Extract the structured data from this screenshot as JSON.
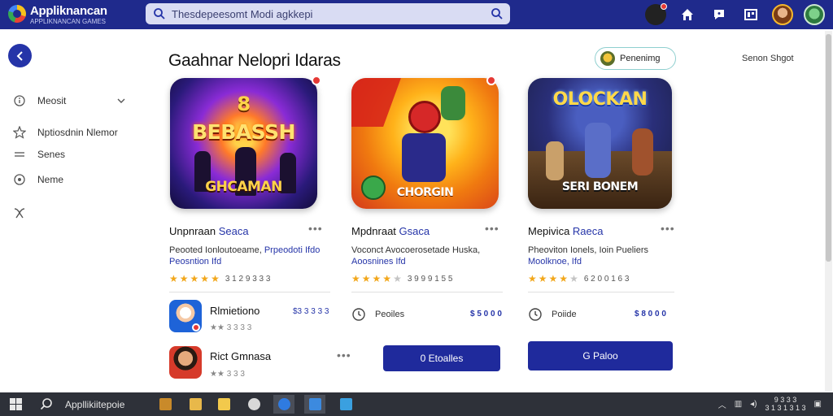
{
  "app": {
    "name": "Appliknancan",
    "tagline": "APPLIKNANCAN GAMES"
  },
  "search": {
    "placeholder": "Thesdepeesomt Modi agkkepi",
    "icon": "search-icon"
  },
  "topbar": {
    "icons": [
      "profile-avatar-icon",
      "home-icon",
      "chat-icon",
      "library-icon",
      "user-avatar-icon",
      "account-avatar-icon"
    ]
  },
  "sidebar": {
    "back": "back-icon",
    "items": [
      {
        "label": "Meosit",
        "icon": "info-icon"
      },
      {
        "label": "Nptiosdnin Nlemor",
        "icon": "star-icon"
      },
      {
        "label": "Senes",
        "icon": "menu-icon"
      },
      {
        "label": "Neme",
        "icon": "settings-icon"
      },
      {
        "label": "",
        "icon": "wrench-icon"
      }
    ]
  },
  "main": {
    "title": "Gaahnar Nelopri Idaras",
    "filter_button": "Penenimg",
    "sort_label": "Senon Shgot",
    "cards": [
      {
        "art_top": "8",
        "art_title": "BEBASSH",
        "art_bottom": "GHCAMAN",
        "name": "Unpnraan",
        "category": "Seaca",
        "desc_plain": "Peooted Ionloutoeame,",
        "desc_link": "Prpeodoti Ifdo",
        "desc_line2": "Peosntion Ifd",
        "stars": 5,
        "rating_count": "3 1 2 9 3 3 3"
      },
      {
        "art_title": "CHORGIN",
        "name": "Mpdnraat",
        "category": "Gsaca",
        "desc_plain": "Voconct Avocoerosetade Huska,",
        "desc_line2": "Aoosnines Ifd",
        "stars": 3.5,
        "rating_count": "3 9 9 9 1 5 5"
      },
      {
        "art_title": "OLOCKAN",
        "art_bottom": "SERI BONEM",
        "name": "Mepivica",
        "category": "Raeca",
        "desc_plain": "Pheoviton Ionels, Ioin Pueliers",
        "desc_line2": "Moolknoe, Ifd",
        "stars": 4,
        "rating_count": "6 2 0 0 1 6 3"
      }
    ],
    "mini_apps": [
      {
        "name": "Rlmietiono",
        "price": "$3 3 3 3 3",
        "rating": "3 3 3 3"
      },
      {
        "name": "Rict Gmnasa",
        "rating": "3 3 3"
      }
    ],
    "row_items": [
      {
        "label": "Peoiles",
        "price": "$ 5 0 0 0"
      },
      {
        "label": "Poiide",
        "price": "$ 8 0 0 0"
      }
    ],
    "cta_buttons": [
      "0 Etoalles",
      "G Paloo"
    ]
  },
  "taskbar": {
    "search_text": "Appllikiitepoie",
    "time": "9 3 3 3",
    "date": "3 1 3 1 3 1 3"
  },
  "colors": {
    "topbar": "#1f2a8c",
    "accent": "#2534a8",
    "star": "#f2a71b",
    "cta": "#1f2a9c",
    "taskbar": "#2e3139"
  }
}
